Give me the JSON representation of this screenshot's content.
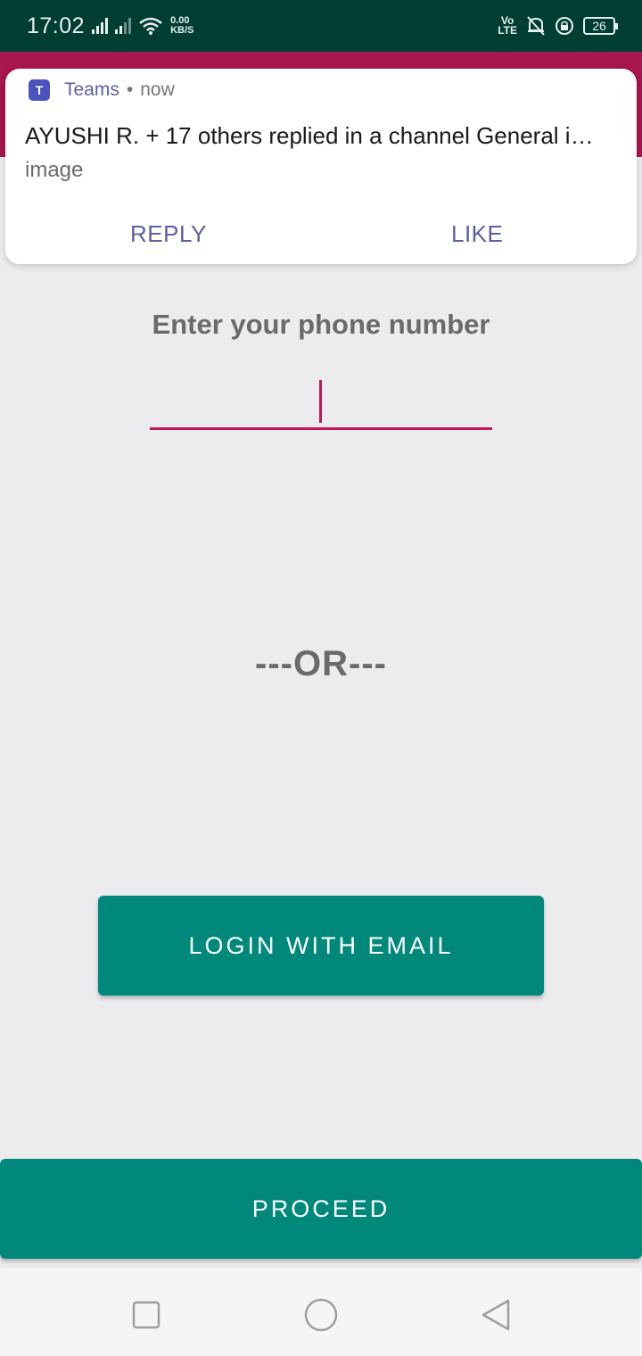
{
  "status_bar": {
    "time": "17:02",
    "net_speed_value": "0.00",
    "net_speed_unit": "KB/S",
    "volte_top": "Vo",
    "volte_bottom": "LTE",
    "battery": "26"
  },
  "notification": {
    "app_name": "Teams",
    "separator": "•",
    "time": "now",
    "title": "AYUSHI R. + 17 others replied in a channel General i…",
    "body": "image",
    "actions": [
      "REPLY",
      "LIKE"
    ]
  },
  "form": {
    "phone_label": "Enter your phone number",
    "phone_value": "",
    "or_text": "---OR---",
    "login_email_label": "LOGIN WITH EMAIL",
    "proceed_label": "PROCEED"
  },
  "colors": {
    "status_bar": "#003d33",
    "app_bar": "#a8174d",
    "accent": "#c2185b",
    "button": "#00897b",
    "teams": "#5b5fa3"
  }
}
